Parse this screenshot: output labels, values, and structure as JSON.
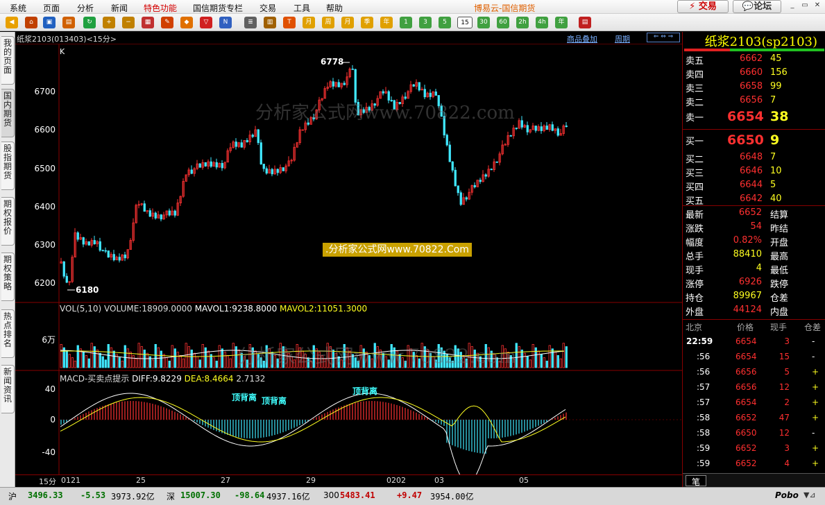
{
  "menu": {
    "items": [
      "系统",
      "页面",
      "分析",
      "新闻",
      "特色功能",
      "国信期货专栏",
      "交易",
      "工具",
      "帮助"
    ],
    "highlight": "特色功能",
    "brand": "博易云-国信期货",
    "trade": "交易",
    "forum": "论坛"
  },
  "toolbar": {
    "periods": [
      "1",
      "3",
      "5",
      "15",
      "30",
      "60",
      "2h",
      "4h",
      "日",
      "周",
      "月",
      "季",
      "年"
    ]
  },
  "sidebar": {
    "tabs": [
      "我的页面",
      "国内期货",
      "股指期货",
      "期权报价",
      "期权策略",
      "热点排名",
      "新闻资讯"
    ]
  },
  "chart_header": {
    "title": "纸浆2103(013403)<15分>",
    "overlay": "商品叠加",
    "period": "周期"
  },
  "kline": {
    "label": "K",
    "high_label": "6778",
    "low_label": "6180",
    "yticks": [
      "6700",
      "6600",
      "6500",
      "6400",
      "6300",
      "6200"
    ]
  },
  "volume": {
    "header_name": "VOL(5,10)",
    "header_vol": "VOLUME:18909.0000",
    "mavol1": "MAVOL1:9238.8000",
    "mavol2": "MAVOL2:11051.3000",
    "ytick": "6万"
  },
  "macd": {
    "header_name": "MACD-买卖点提示",
    "diff": "DIFF:9.8229",
    "dea": "DEA:8.4664",
    "val": "2.7132",
    "yticks": [
      "40",
      "0",
      "-40"
    ],
    "annotations": [
      "顶背离",
      "顶背离",
      "顶背离"
    ]
  },
  "xaxis": {
    "period": "15分",
    "dates": [
      "0121",
      "25",
      "27",
      "29",
      "0202",
      "03",
      "05"
    ]
  },
  "watermark": {
    "text1": "分析家公式网www.70822.com",
    "text2": ".分析家公式网www.70822.Com",
    "text3": "分析家公式网www.70822.com"
  },
  "quote": {
    "name": "纸浆2103(sp2103)",
    "asks": [
      {
        "label": "卖五",
        "price": "6662",
        "vol": "45"
      },
      {
        "label": "卖四",
        "price": "6660",
        "vol": "156"
      },
      {
        "label": "卖三",
        "price": "6658",
        "vol": "99"
      },
      {
        "label": "卖二",
        "price": "6656",
        "vol": "7"
      },
      {
        "label": "卖一",
        "price": "6654",
        "vol": "38"
      }
    ],
    "bids": [
      {
        "label": "买一",
        "price": "6650",
        "vol": "9"
      },
      {
        "label": "买二",
        "price": "6648",
        "vol": "7"
      },
      {
        "label": "买三",
        "price": "6646",
        "vol": "10"
      },
      {
        "label": "买四",
        "price": "6644",
        "vol": "5"
      },
      {
        "label": "买五",
        "price": "6642",
        "vol": "40"
      }
    ],
    "stats": [
      {
        "l": "最新",
        "v": "6652",
        "c": "redv",
        "l2": "结算"
      },
      {
        "l": "涨跌",
        "v": "54",
        "c": "redv",
        "l2": "昨结"
      },
      {
        "l": "幅度",
        "v": "0.82%",
        "c": "redv",
        "l2": "开盘"
      },
      {
        "l": "总手",
        "v": "88410",
        "c": "yelv",
        "l2": "最高"
      },
      {
        "l": "现手",
        "v": "4",
        "c": "yelv",
        "l2": "最低"
      },
      {
        "l": "涨停",
        "v": "6926",
        "c": "redv",
        "l2": "跌停"
      },
      {
        "l": "持仓",
        "v": "89967",
        "c": "yelv",
        "l2": "仓差"
      },
      {
        "l": "外盘",
        "v": "44124",
        "c": "redv",
        "l2": "内盘"
      }
    ],
    "tick_header": [
      "北京",
      "价格",
      "现手",
      "仓差"
    ],
    "ticks": [
      {
        "t": "22:59",
        "p": "6654",
        "v": "3",
        "d": "-"
      },
      {
        "t": ":56",
        "p": "6654",
        "v": "15",
        "d": "-"
      },
      {
        "t": ":56",
        "p": "6656",
        "v": "5",
        "d": "+"
      },
      {
        "t": ":57",
        "p": "6656",
        "v": "12",
        "d": "+"
      },
      {
        "t": ":57",
        "p": "6654",
        "v": "2",
        "d": "+"
      },
      {
        "t": ":58",
        "p": "6652",
        "v": "47",
        "d": "+"
      },
      {
        "t": ":58",
        "p": "6650",
        "v": "12",
        "d": "-"
      },
      {
        "t": ":59",
        "p": "6652",
        "v": "3",
        "d": "+"
      },
      {
        "t": ":59",
        "p": "6652",
        "v": "4",
        "d": "+"
      }
    ],
    "tab": "笔"
  },
  "status": {
    "sh_label": "沪",
    "sh_idx": "3496.33",
    "sh_chg": "-5.53",
    "sh_amt": "3973.92亿",
    "sz_label": "深",
    "sz_idx": "15007.30",
    "sz_chg": "-98.64",
    "sz_amt": "4937.16亿",
    "c300_label": "300",
    "c300_idx": "5483.41",
    "c300_chg": "+9.47",
    "c300_amt": "3954.00亿",
    "pobo": "Pobo"
  }
}
